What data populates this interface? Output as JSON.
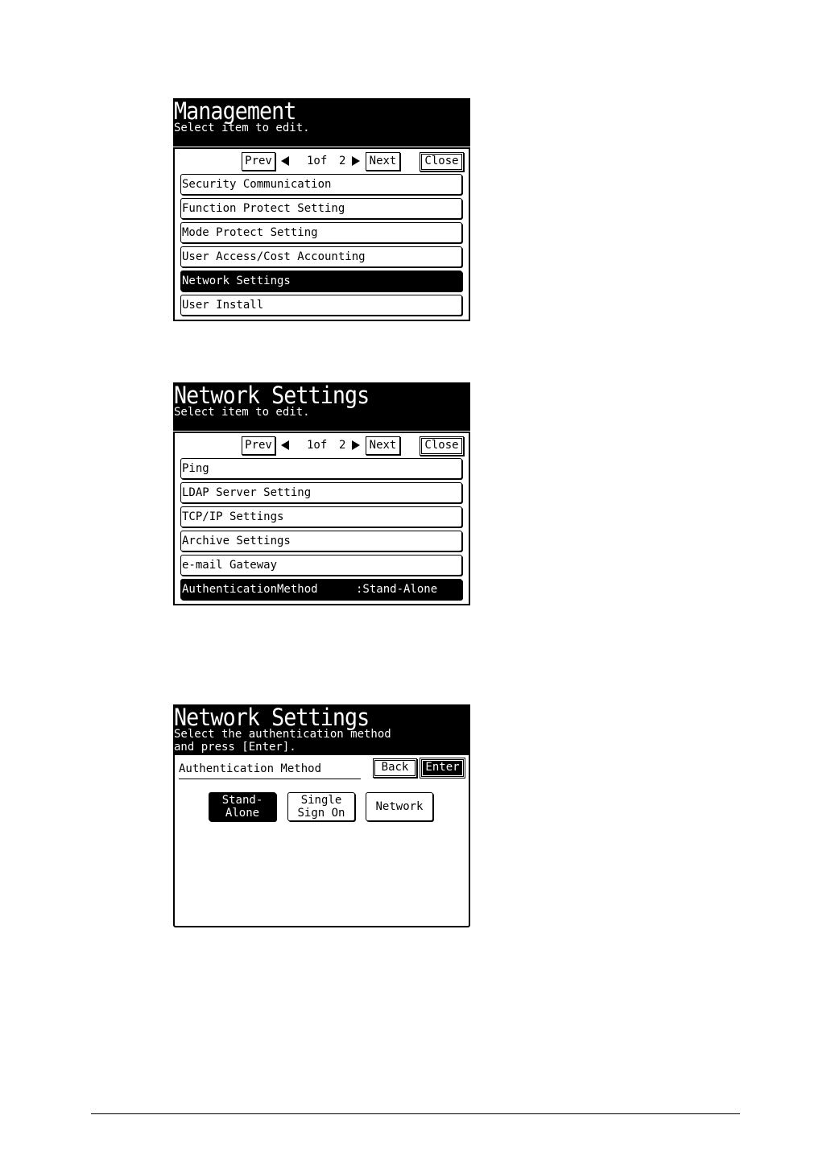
{
  "screens": [
    {
      "title": "Management",
      "subtitle": "Select item to edit.",
      "nav": {
        "prev": "Prev",
        "page": "1of",
        "total": "2",
        "next": "Next",
        "close": "Close"
      },
      "items": [
        {
          "label": "Security Communication"
        },
        {
          "label": "Function Protect Setting"
        },
        {
          "label": "Mode Protect Setting"
        },
        {
          "label": "User Access/Cost Accounting"
        },
        {
          "label": "Network Settings",
          "selected": true
        },
        {
          "label": "User Install"
        }
      ]
    },
    {
      "title": "Network Settings",
      "subtitle": "Select item to edit.",
      "nav": {
        "prev": "Prev",
        "page": "1of",
        "total": "2",
        "next": "Next",
        "close": "Close"
      },
      "items": [
        {
          "label": "Ping"
        },
        {
          "label": "LDAP Server Setting"
        },
        {
          "label": "TCP/IP Settings"
        },
        {
          "label": "Archive Settings"
        },
        {
          "label": "e-mail Gateway"
        },
        {
          "label": "AuthenticationMethod",
          "value": ":Stand-Alone",
          "selected": true
        }
      ]
    },
    {
      "title": "Network Settings",
      "subtitle_line1": "Select the authentication method",
      "subtitle_line2": "and press [Enter].",
      "field_label": "Authentication Method",
      "back": "Back",
      "enter": "Enter",
      "options": [
        {
          "label": "Stand-\nAlone",
          "selected": true
        },
        {
          "label": "Single\nSign On"
        },
        {
          "label": "Network"
        }
      ]
    }
  ],
  "icons": {
    "prev_arrow": "triangle-left-icon",
    "next_arrow": "triangle-right-icon"
  }
}
